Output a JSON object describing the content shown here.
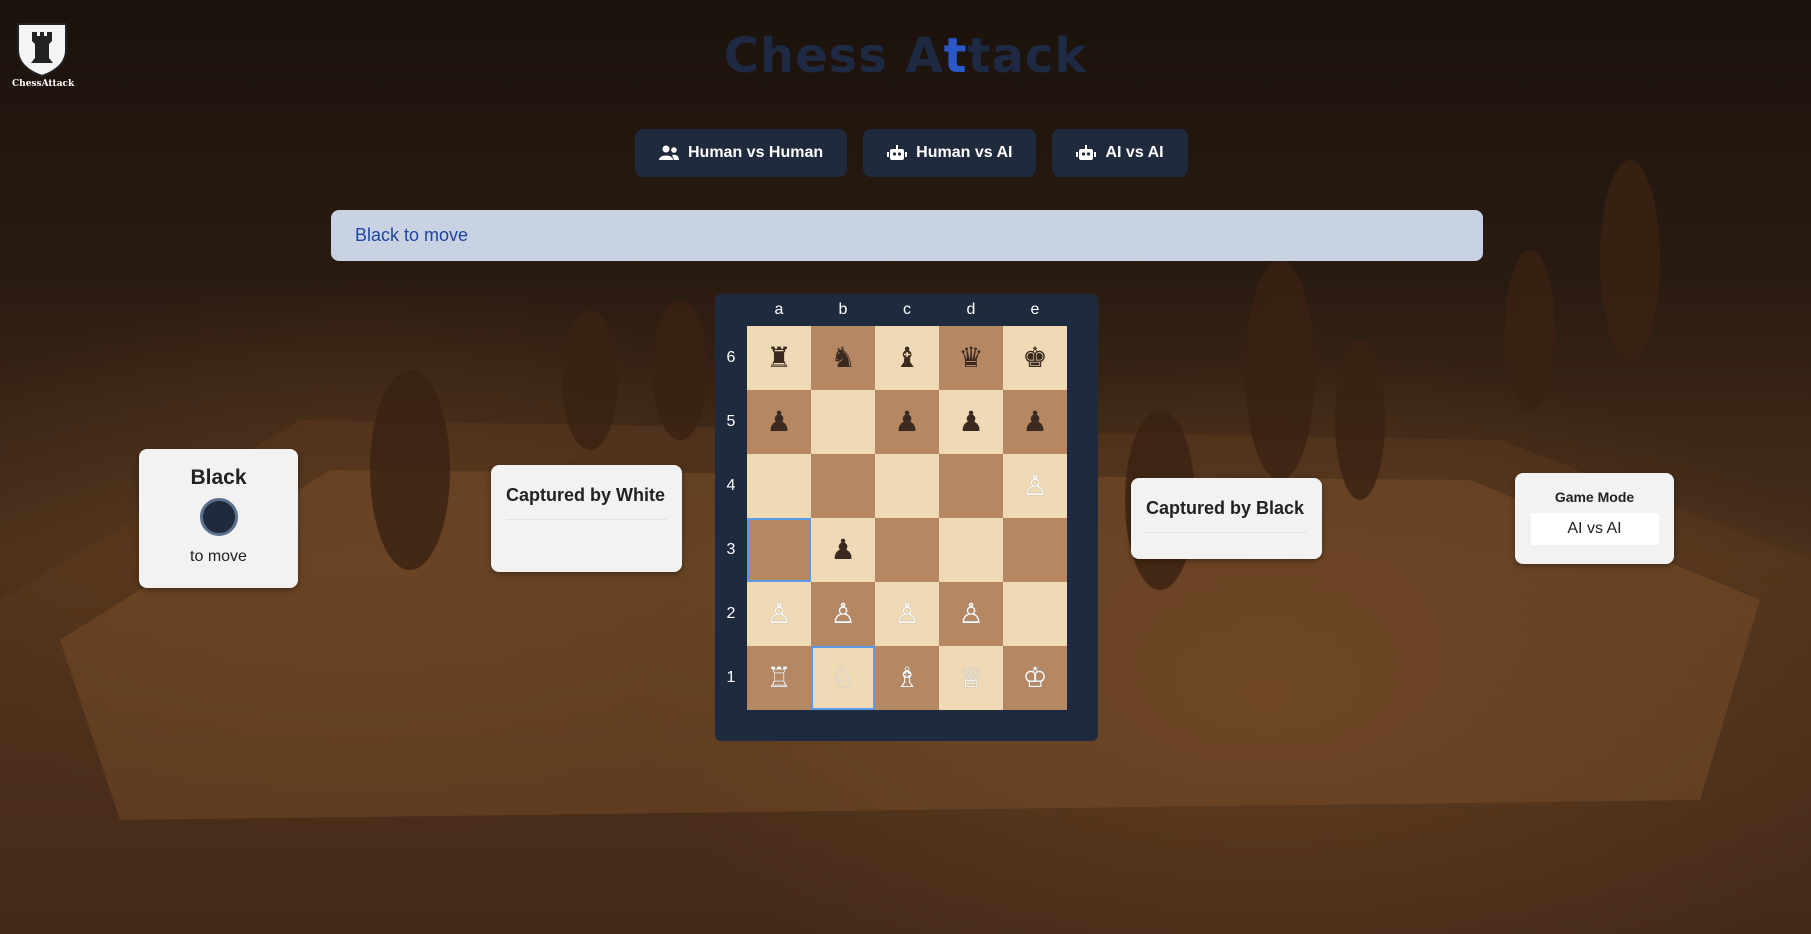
{
  "logo": {
    "text": "ChessAttack",
    "icon": "rook-shield-icon"
  },
  "title": {
    "part1": "Chess A",
    "highlight": "t",
    "part2": "tack"
  },
  "modes": [
    {
      "label": "Human vs Human",
      "icon": "users-icon"
    },
    {
      "label": "Human vs AI",
      "icon": "robot-icon"
    },
    {
      "label": "AI vs AI",
      "icon": "robot-icon"
    }
  ],
  "status": "Black to move",
  "turn": {
    "color_name": "Black",
    "sub": "to move"
  },
  "captured_white": {
    "title": "Captured by White"
  },
  "captured_black": {
    "title": "Captured by Black"
  },
  "game_mode": {
    "label": "Game Mode",
    "value": "AI vs AI"
  },
  "board": {
    "files": [
      "a",
      "b",
      "c",
      "d",
      "e"
    ],
    "ranks": [
      "6",
      "5",
      "4",
      "3",
      "2",
      "1"
    ],
    "colors": {
      "light": "#f0dab5",
      "dark": "#b58863",
      "highlight": "#5a9ae8"
    },
    "selected": [
      "a3",
      "b1"
    ],
    "pieces": {
      "a6": "♜",
      "b6": "♞",
      "c6": "♝",
      "d6": "♛",
      "e6": "♚",
      "a5": "♟",
      "c5": "♟",
      "d5": "♟",
      "e5": "♟",
      "e4": "♙",
      "b3": "♟",
      "a2": "♙",
      "b2": "♙",
      "c2": "♙",
      "d2": "♙",
      "a1": "♖",
      "b1": "♘",
      "c1": "♗",
      "d1": "♕",
      "e1": "♔"
    }
  }
}
